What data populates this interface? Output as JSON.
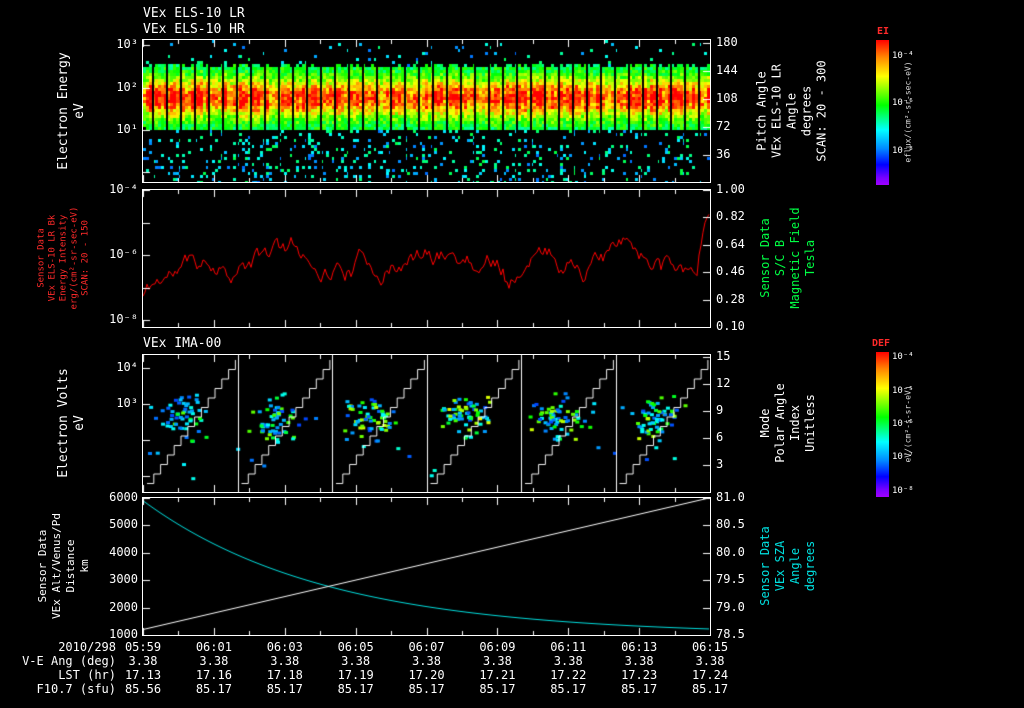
{
  "titles": {
    "p1a": "VEx ELS-10 LR",
    "p1b": "VEx ELS-10 HR",
    "p3": "VEx IMA-00"
  },
  "panel1": {
    "left_label": "Electron Energy\neV",
    "left_ticks": [
      "10³",
      "10²",
      "10¹"
    ],
    "right_ticks": [
      "180",
      "144",
      "108",
      "72",
      "36"
    ],
    "right_label": "Pitch Angle\nVEx ELS-10 LR\nAngle\ndegrees\nSCAN: 20 - 300"
  },
  "panel2": {
    "left_label": "Sensor Data\nVEx ELS-10 LR Bk\nEnergy Intensity\nerg/(cm²-sr-sec-eV)\nSCAN: 20 - 150",
    "left_ticks": [
      "10⁻⁴",
      "10⁻⁶",
      "10⁻⁸"
    ],
    "right_ticks": [
      "1.00",
      "0.82",
      "0.64",
      "0.46",
      "0.28",
      "0.10"
    ],
    "right_label": "Sensor Data\nS/C B\nMagnetic Field\nTesla"
  },
  "panel3": {
    "left_label": "Electron Volts\neV",
    "left_ticks": [
      "10⁴",
      "10³"
    ],
    "right_ticks": [
      "15",
      "12",
      "9",
      "6",
      "3"
    ],
    "right_label": "Mode\nPolar Angle\nIndex\nUnitless"
  },
  "panel4": {
    "left_label": "Sensor Data\nVEx Alt/Venus/Pd\nDistance\nkm",
    "left_ticks": [
      "6000",
      "5000",
      "4000",
      "3000",
      "2000",
      "1000"
    ],
    "right_ticks": [
      "81.0",
      "80.5",
      "80.0",
      "79.5",
      "79.0",
      "78.5"
    ],
    "right_label": "Sensor Data\nVEx SZA\nAngle\ndegrees"
  },
  "colorbars": {
    "ei": {
      "title": "EI",
      "ticks": [
        "10⁻⁴",
        "10⁻⁶",
        "10⁻⁸"
      ],
      "units": "eflux/(cm²-sr-sec-eV)"
    },
    "def": {
      "title": "DEF",
      "ticks": [
        "10⁻⁴",
        "10⁻⁵",
        "10⁻⁶",
        "10⁻⁷",
        "10⁻⁸"
      ],
      "units": "eV/(cm²-s-sr-eV)"
    }
  },
  "time_axis": {
    "date": "2010/298",
    "times": [
      "05:59",
      "06:01",
      "06:03",
      "06:05",
      "06:07",
      "06:09",
      "06:11",
      "06:13",
      "06:15"
    ]
  },
  "table": {
    "rows": [
      {
        "label": "V-E Ang (deg)",
        "values": [
          "3.38",
          "3.38",
          "3.38",
          "3.38",
          "3.38",
          "3.38",
          "3.38",
          "3.38",
          "3.38"
        ]
      },
      {
        "label": "LST (hr)",
        "values": [
          "17.13",
          "17.16",
          "17.18",
          "17.19",
          "17.20",
          "17.21",
          "17.22",
          "17.23",
          "17.24"
        ]
      },
      {
        "label": "F10.7 (sfu)",
        "values": [
          "85.56",
          "85.17",
          "85.17",
          "85.17",
          "85.17",
          "85.17",
          "85.17",
          "85.17",
          "85.17"
        ]
      }
    ]
  },
  "chart_data": [
    {
      "type": "heatmap",
      "title": "VEx ELS-10 LR / VEx ELS-10 HR",
      "ylabel": "Electron Energy (eV)",
      "y_scale": "log",
      "y_ticks": [
        "10³",
        "10²",
        "10¹"
      ],
      "x_ticks": [
        "05:59",
        "06:01",
        "06:03",
        "06:05",
        "06:07",
        "06:09",
        "06:11",
        "06:13",
        "06:15"
      ],
      "right_axis": {
        "label": "Pitch Angle VEx ELS-10 LR Angle degrees SCAN: 20 - 300",
        "ticks": [
          180,
          144,
          108,
          72,
          36
        ]
      },
      "colorbar": {
        "name": "EI",
        "ticks": [
          "10⁻⁴",
          "10⁻⁶",
          "10⁻⁸"
        ],
        "units": "eflux/(cm²-sr-sec-eV)"
      },
      "description": "Continuous intense band (green-yellow-red) centered near 100 eV across the whole interval, cyan/blue scattered counts above and below, ~40 narrow vertical data gaps.",
      "render": {
        "seed": 7,
        "band_center_frac": 0.4,
        "band_sigma_frac": 0.15,
        "gap_spacing_px": 14
      }
    },
    {
      "type": "line",
      "name": "VEx ELS-10 LR Bk Energy Intensity",
      "color": "#ff0000",
      "y_scale": "log",
      "y_ticks": [
        "10⁻⁴",
        "10⁻⁶",
        "10⁻⁸"
      ],
      "approx_log10_at_ticks": [
        -7.4,
        -6.2,
        -6.0,
        -5.9,
        -5.8,
        -6.0,
        -5.9,
        -6.1,
        -4.8
      ],
      "right_axis": {
        "label": "S/C B Magnetic Field (Tesla)",
        "ticks": [
          1.0,
          0.82,
          0.64,
          0.46,
          0.28,
          0.1
        ]
      },
      "render": {
        "seed": 11,
        "mean_log": -6.05
      }
    },
    {
      "type": "heatmap",
      "title": "VEx IMA-00",
      "ylabel": "Electron Volts (eV)",
      "y_scale": "log",
      "y_ticks": [
        "10⁴",
        "10³"
      ],
      "right_axis": {
        "label": "Mode Polar Angle Index Unitless",
        "ticks": [
          15,
          12,
          9,
          6,
          3
        ]
      },
      "colorbar": {
        "name": "DEF",
        "ticks": [
          "10⁻⁴",
          "10⁻⁵",
          "10⁻⁶",
          "10⁻⁷",
          "10⁻⁸"
        ],
        "units": "eV/(cm²-s-sr-eV)"
      },
      "description": "Six measurement cycles separated by white vertical lines; each cycle shows a white stair-step energy-sweep trace and a cluster of blue/cyan/green counts near mid energies.",
      "render": {
        "seed": 23,
        "segments": 6,
        "cluster_brightness": [
          0.45,
          0.6,
          0.85,
          0.9,
          0.85,
          0.8
        ]
      }
    },
    {
      "type": "line",
      "x_ticks": [
        "05:59",
        "06:01",
        "06:03",
        "06:05",
        "06:07",
        "06:09",
        "06:11",
        "06:13",
        "06:15"
      ],
      "left_axis": {
        "label": "VEx Alt/Venus/Pd Distance (km)",
        "range": [
          1000,
          6000
        ]
      },
      "right_axis": {
        "label": "VEx SZA Angle (degrees)",
        "range": [
          78.5,
          81.0
        ]
      },
      "series": [
        {
          "name": "VEx Alt/Venus/Pd Distance",
          "color": "#00e0e0",
          "axis": "left",
          "values_at_ticks": [
            5900,
            4330,
            3260,
            2530,
            2040,
            1710,
            1480,
            1330,
            1220
          ]
        },
        {
          "name": "VEx SZA Angle",
          "color": "#ffffff",
          "axis": "right",
          "values_at_ticks": [
            78.6,
            78.9,
            79.2,
            79.5,
            79.8,
            80.1,
            80.4,
            80.7,
            81.0
          ]
        }
      ]
    }
  ]
}
